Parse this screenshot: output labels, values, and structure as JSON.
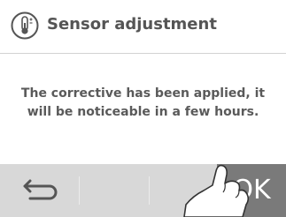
{
  "header": {
    "title": "Sensor adjustment",
    "icon": "thermometer-icon"
  },
  "message": {
    "line1": "The corrective has been applied, it",
    "line2": "will be noticeable in a few hours."
  },
  "footer": {
    "back_icon": "back-arrow-icon",
    "ok_label": "OK",
    "ok_color": "#7a7a7a"
  }
}
